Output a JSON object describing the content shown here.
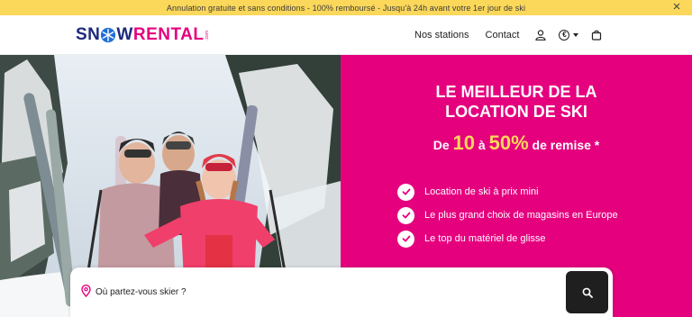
{
  "banner": {
    "text": "Annulation gratuite et sans conditions - 100% remboursé - Jusqu'à 24h avant votre 1er jour de ski",
    "close_icon": "close-icon",
    "background": "#fbd75a"
  },
  "header": {
    "logo": {
      "part1": "SN",
      "part2": "W",
      "part3": "RENTAL",
      "suffix": ".com"
    },
    "nav": [
      {
        "label": "Nos stations"
      },
      {
        "label": "Contact"
      }
    ],
    "icons": [
      "user-icon",
      "currency-selector",
      "cart-icon"
    ],
    "currency_symbol": "€"
  },
  "hero": {
    "title_line1": "LE MEILLEUR DE LA",
    "title_line2": "LOCATION DE SKI",
    "discount": {
      "prefix": "De",
      "low": "10",
      "middle": "à",
      "high": "50%",
      "suffix": "de remise *"
    },
    "features": [
      "Location de ski à prix mini",
      "Le plus grand choix de magasins en Europe",
      "Le top du matériel de glisse"
    ],
    "accent": "#e5007e",
    "highlight": "#fbd75a"
  },
  "search": {
    "placeholder": "Où partez-vous skier ?",
    "value": "",
    "button_icon": "search-icon"
  }
}
